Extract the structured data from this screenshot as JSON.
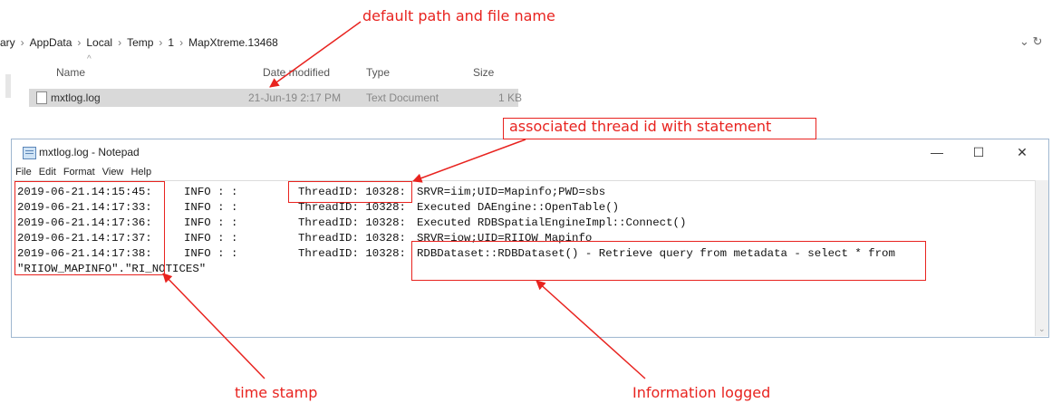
{
  "annotations": {
    "path": "default path and file name",
    "thread": "associated thread id with statement",
    "timestamp": "time stamp",
    "info": "Information logged"
  },
  "explorer": {
    "breadcrumb": [
      "ary",
      "AppData",
      "Local",
      "Temp",
      "1",
      "MapXtreme.13468"
    ],
    "columns": {
      "name": "Name",
      "date": "Date modified",
      "type": "Type",
      "size": "Size"
    },
    "file": {
      "name": "mxtlog.log",
      "date": "21-Jun-19 2:17 PM",
      "type": "Text Document",
      "size": "1 KB"
    }
  },
  "notepad": {
    "title": "mxtlog.log - Notepad",
    "menu": [
      "File",
      "Edit",
      "Format",
      "View",
      "Help"
    ],
    "lines": [
      {
        "ts": "2019-06-21.14:15:45:",
        "level": "INFO : :",
        "thread": "ThreadID: 10328:",
        "msg": "SRVR=iim;UID=Mapinfo;PWD=sbs"
      },
      {
        "ts": "2019-06-21.14:17:33:",
        "level": "INFO : :",
        "thread": "ThreadID: 10328:",
        "msg": "Executed DAEngine::OpenTable()"
      },
      {
        "ts": "2019-06-21.14:17:36:",
        "level": "INFO : :",
        "thread": "ThreadID: 10328:",
        "msg": "Executed RDBSpatialEngineImpl::Connect()"
      },
      {
        "ts": "2019-06-21.14:17:37:",
        "level": "INFO : :",
        "thread": "ThreadID: 10328:",
        "msg": "SRVR=iow;UID=RIIOW_Mapinfo"
      },
      {
        "ts": "2019-06-21.14:17:38:",
        "level": "INFO : :",
        "thread": "ThreadID: 10328:",
        "msg": "RDBDataset::RDBDataset() - Retrieve query from metadata - select * from"
      }
    ],
    "wrap_line": "\"RIIOW_MAPINFO\".\"RI_NOTICES\"",
    "buttons": {
      "minimize": "—",
      "maximize": "☐",
      "close": "✕"
    }
  },
  "colors": {
    "annotation": "#e8231f",
    "selection": "#d9d9d9"
  }
}
